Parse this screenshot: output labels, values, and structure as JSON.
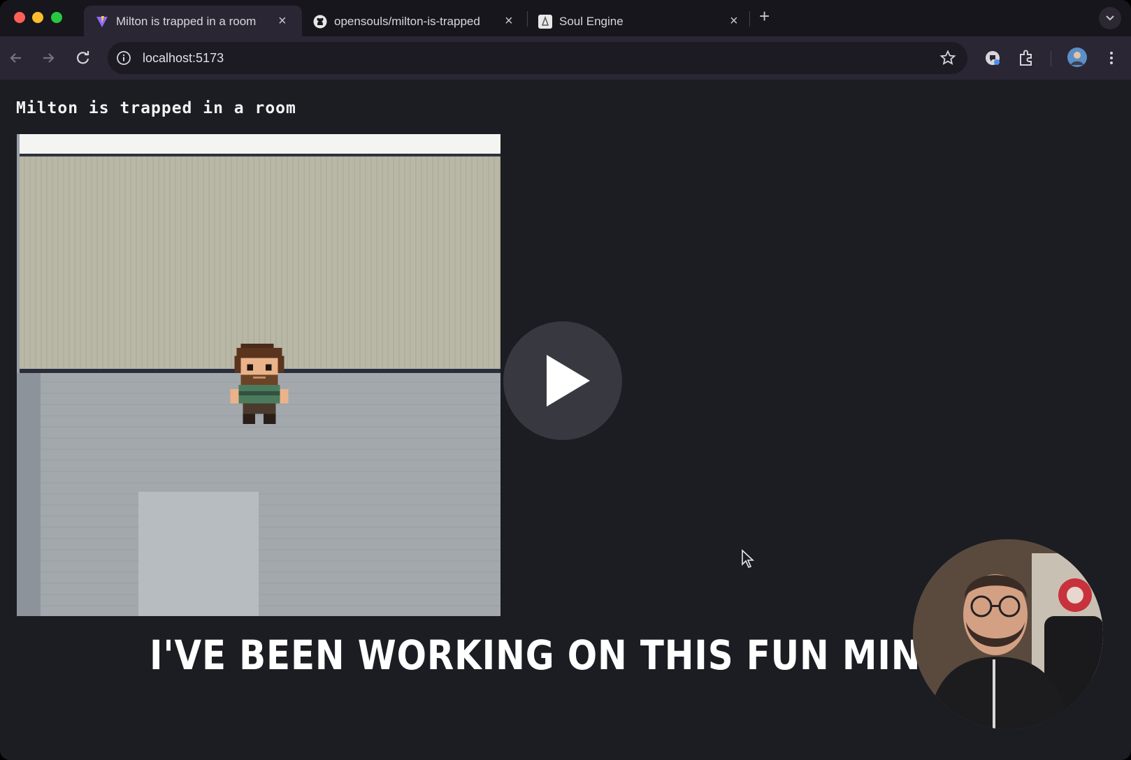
{
  "browser": {
    "tabs": [
      {
        "title": "Milton is trapped in a room",
        "icon": "vite-icon",
        "active": true
      },
      {
        "title": "opensouls/milton-is-trapped",
        "icon": "github-icon",
        "active": false
      },
      {
        "title": "Soul Engine",
        "icon": "soul-engine-icon",
        "active": false
      }
    ],
    "url": "localhost:5173"
  },
  "page": {
    "title": "Milton is trapped in a room"
  },
  "video": {
    "caption": "I'VE BEEN WORKING ON THIS FUN MINI GAME"
  },
  "colors": {
    "wall": "#b9b7a6",
    "floor": "#a3a8ad",
    "page_bg": "#1b1d23",
    "caption": "#ffffff"
  }
}
